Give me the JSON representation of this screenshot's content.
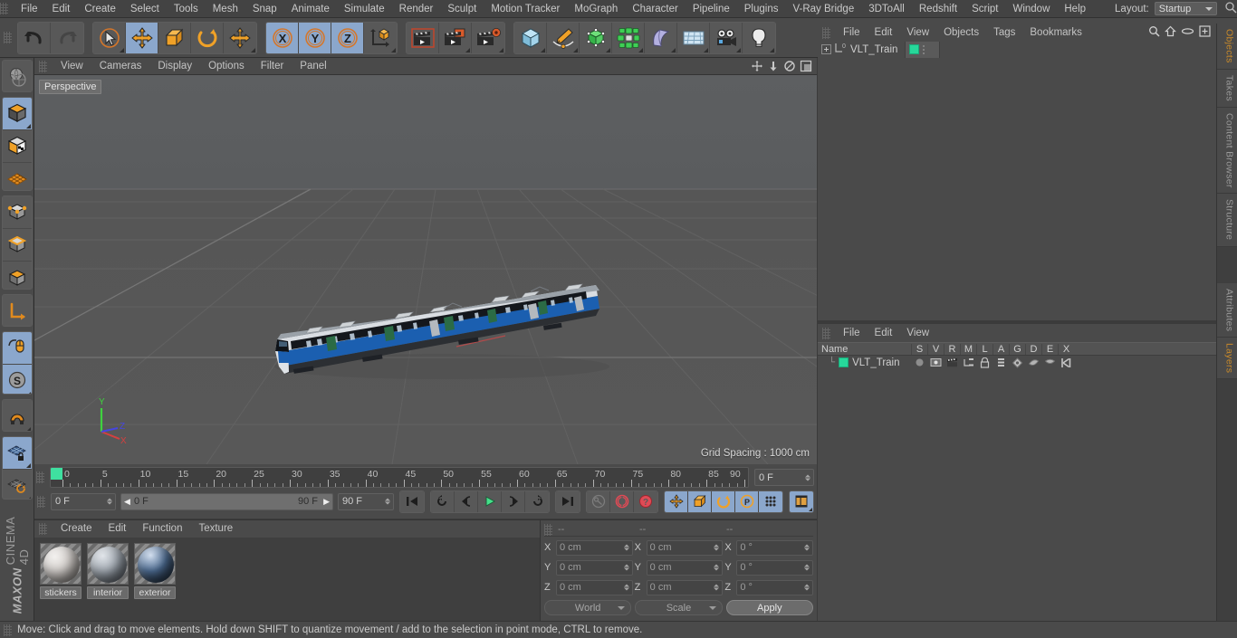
{
  "app": {
    "brand_top": "MAXON",
    "brand_bottom": "CINEMA 4D"
  },
  "menubar": {
    "items": [
      {
        "label": "File"
      },
      {
        "label": "Edit"
      },
      {
        "label": "Create"
      },
      {
        "label": "Select"
      },
      {
        "label": "Tools"
      },
      {
        "label": "Mesh"
      },
      {
        "label": "Snap"
      },
      {
        "label": "Animate"
      },
      {
        "label": "Simulate"
      },
      {
        "label": "Render"
      },
      {
        "label": "Sculpt"
      },
      {
        "label": "Motion Tracker"
      },
      {
        "label": "MoGraph"
      },
      {
        "label": "Character"
      },
      {
        "label": "Pipeline"
      },
      {
        "label": "Plugins"
      },
      {
        "label": "V-Ray Bridge"
      },
      {
        "label": "3DToAll"
      },
      {
        "label": "Redshift"
      },
      {
        "label": "Script"
      },
      {
        "label": "Window"
      },
      {
        "label": "Help"
      }
    ],
    "layout_label": "Layout:",
    "layout_value": "Startup",
    "search_icon": "search-icon"
  },
  "toolbar": {
    "groups": [
      {
        "name": "history",
        "buttons": [
          {
            "name": "undo-button",
            "icon": "undo-arrow-icon",
            "active": false
          },
          {
            "name": "redo-button",
            "icon": "redo-arrow-icon",
            "active": false
          }
        ]
      },
      {
        "name": "transform-tools",
        "buttons": [
          {
            "name": "live-selection-tool",
            "icon": "cursor-circle-icon",
            "active": false
          },
          {
            "name": "move-tool",
            "icon": "move-arrows-icon",
            "active": true
          },
          {
            "name": "scale-tool",
            "icon": "scale-box-icon",
            "active": false
          },
          {
            "name": "rotate-tool",
            "icon": "rotate-ring-icon",
            "active": false
          },
          {
            "name": "dynamic-place-tool",
            "icon": "move-arrows-icon",
            "active": false
          }
        ]
      },
      {
        "name": "axis-locks",
        "buttons": [
          {
            "name": "lock-x-axis-button",
            "icon": "x-axis-icon",
            "active": true
          },
          {
            "name": "lock-y-axis-button",
            "icon": "y-axis-icon",
            "active": true
          },
          {
            "name": "lock-z-axis-button",
            "icon": "z-axis-icon",
            "active": true
          },
          {
            "name": "world-object-axis-button",
            "icon": "world-axis-cube-icon",
            "active": false
          }
        ]
      },
      {
        "name": "render-tools",
        "buttons": [
          {
            "name": "render-view-button",
            "icon": "clapperboard-frame-icon",
            "active": false
          },
          {
            "name": "render-to-picture-viewer-button",
            "icon": "clapperboard-window-icon",
            "active": false
          },
          {
            "name": "render-settings-button",
            "icon": "clapperboard-gear-icon",
            "active": false
          }
        ]
      },
      {
        "name": "object-creation",
        "buttons": [
          {
            "name": "add-primitive-cube-button",
            "icon": "cube-icon",
            "active": false
          },
          {
            "name": "add-spline-pen-button",
            "icon": "pen-spline-icon",
            "active": false
          },
          {
            "name": "add-generator-button",
            "icon": "green-cube-generator-icon",
            "active": false
          },
          {
            "name": "add-array-button",
            "icon": "array-cluster-icon",
            "active": false
          },
          {
            "name": "add-deformer-bend-button",
            "icon": "bend-deformer-icon",
            "active": false
          },
          {
            "name": "add-scene-floor-button",
            "icon": "floor-grid-icon",
            "active": false
          },
          {
            "name": "add-camera-button",
            "icon": "camera-icon",
            "active": false
          },
          {
            "name": "add-light-button",
            "icon": "light-bulb-icon",
            "active": false
          }
        ]
      }
    ]
  },
  "leftbar": {
    "groups": [
      {
        "name": "render-region",
        "buttons": [
          {
            "name": "make-editable-globe-button",
            "icon": "globe-sphere-icon",
            "active": false
          }
        ]
      },
      {
        "name": "edit-modes",
        "buttons": [
          {
            "name": "model-mode-button",
            "icon": "model-cube-icon",
            "active": true
          },
          {
            "name": "texture-mode-button",
            "icon": "texture-cube-icon",
            "active": false
          },
          {
            "name": "uv-mode-button",
            "icon": "uv-mesh-icon",
            "active": false
          }
        ]
      },
      {
        "name": "component-modes",
        "buttons": [
          {
            "name": "points-mode-button",
            "icon": "points-cube-icon",
            "active": false
          },
          {
            "name": "edges-mode-button",
            "icon": "edges-cube-icon",
            "active": false
          },
          {
            "name": "polygons-mode-button",
            "icon": "polygons-cube-icon",
            "active": false
          }
        ]
      },
      {
        "name": "axis-mode",
        "buttons": [
          {
            "name": "enable-axis-modification-button",
            "icon": "axis-l-icon",
            "active": false
          }
        ]
      },
      {
        "name": "viewport-snap",
        "buttons": [
          {
            "name": "enable-snap-button",
            "icon": "mouse-snap-icon",
            "active": true
          },
          {
            "name": "soft-selection-button",
            "icon": "s-circle-icon",
            "active": true
          }
        ]
      },
      {
        "name": "magnet",
        "buttons": [
          {
            "name": "workplane-magnet-button",
            "icon": "magnet-icon",
            "active": false
          }
        ]
      },
      {
        "name": "workplane",
        "buttons": [
          {
            "name": "lock-workplane-button",
            "icon": "workplane-lock-icon",
            "active": true
          },
          {
            "name": "planar-workplane-button",
            "icon": "workplane-rotate-icon",
            "active": false
          }
        ]
      }
    ]
  },
  "viewport": {
    "menu": [
      {
        "label": "View"
      },
      {
        "label": "Cameras"
      },
      {
        "label": "Display"
      },
      {
        "label": "Options"
      },
      {
        "label": "Filter"
      },
      {
        "label": "Panel"
      }
    ],
    "icons": [
      {
        "name": "viewport-pan-icon"
      },
      {
        "name": "viewport-zoom-icon"
      },
      {
        "name": "viewport-rotate-icon"
      },
      {
        "name": "viewport-maximize-icon"
      }
    ],
    "label": "Perspective",
    "grid_spacing": "Grid Spacing : 1000 cm",
    "axis_labels": {
      "x": "X",
      "y": "Y",
      "z": "Z"
    },
    "axis_colors": {
      "x": "#d44040",
      "y": "#3fd23f",
      "z": "#4646e0"
    },
    "scene_object": "VLT_Train"
  },
  "timeline": {
    "ruler": {
      "start": 0,
      "end": 90,
      "major_step": 5,
      "labels": [
        "0",
        "5",
        "10",
        "15",
        "20",
        "25",
        "30",
        "35",
        "40",
        "45",
        "50",
        "55",
        "60",
        "65",
        "70",
        "75",
        "80",
        "85",
        "90"
      ]
    },
    "current_frame_field": "0 F",
    "frame_start_field": "0 F",
    "range_start": "0 F",
    "range_end": "90 F",
    "frame_end_field": "90 F",
    "transport": [
      {
        "name": "go-to-start-button",
        "icon": "skip-start-icon",
        "active": false
      },
      {
        "name": "play-backward-loop-button",
        "icon": "loop-back-icon",
        "active": false
      },
      {
        "name": "step-back-button",
        "icon": "step-back-icon",
        "active": false
      },
      {
        "name": "play-button",
        "icon": "play-icon",
        "active": false
      },
      {
        "name": "step-forward-button",
        "icon": "step-forward-icon",
        "active": false
      },
      {
        "name": "play-forward-loop-button",
        "icon": "loop-forward-icon",
        "active": false
      },
      {
        "name": "go-to-end-button",
        "icon": "skip-end-icon",
        "active": false
      }
    ],
    "keyframe_tools": [
      {
        "name": "autokeying-button",
        "icon": "key-icon",
        "active": false
      },
      {
        "name": "record-active-objects-button",
        "icon": "record-circle-icon",
        "active": false
      },
      {
        "name": "keyframe-selection-button",
        "icon": "question-circle-icon",
        "active": false
      }
    ],
    "record_toggles": [
      {
        "name": "record-position-button",
        "icon": "move-arrows-icon",
        "active": true
      },
      {
        "name": "record-scale-button",
        "icon": "scale-box-icon",
        "active": true
      },
      {
        "name": "record-rotation-button",
        "icon": "rotate-ring-icon",
        "active": true
      },
      {
        "name": "record-parameter-button",
        "icon": "p-circle-icon",
        "active": true
      },
      {
        "name": "record-pla-button",
        "icon": "point-grid-icon",
        "active": true
      }
    ],
    "timeline-toggle": {
      "name": "timeline-button",
      "icon": "film-strip-icon",
      "active": true
    }
  },
  "materials": {
    "menu": [
      {
        "label": "Create"
      },
      {
        "label": "Edit"
      },
      {
        "label": "Function"
      },
      {
        "label": "Texture"
      }
    ],
    "items": [
      {
        "name": "stickers",
        "color_a": "#e8e6e4",
        "color_b": "#b9b4b0"
      },
      {
        "name": "interior",
        "color_a": "#cfd2d6",
        "color_b": "#7d838b"
      },
      {
        "name": "exterior",
        "color_a": "#b9c6d6",
        "color_b": "#3a4450"
      }
    ]
  },
  "coordinates": {
    "header": [
      "--",
      "--",
      "--"
    ],
    "axes": [
      "X",
      "Y",
      "Z"
    ],
    "position": [
      "0 cm",
      "0 cm",
      "0 cm"
    ],
    "size": [
      "0 cm",
      "0 cm",
      "0 cm"
    ],
    "rotation": [
      "0 °",
      "0 °",
      "0 °"
    ],
    "space_select": "World",
    "mode_select": "Scale",
    "apply_label": "Apply"
  },
  "object_manager": {
    "menu": [
      {
        "label": "File"
      },
      {
        "label": "Edit"
      },
      {
        "label": "View"
      },
      {
        "label": "Objects"
      },
      {
        "label": "Tags"
      },
      {
        "label": "Bookmarks"
      }
    ],
    "icons": [
      {
        "name": "search-icon"
      },
      {
        "name": "home-icon"
      },
      {
        "name": "ellipse-icon"
      },
      {
        "name": "add-box-icon"
      }
    ],
    "rows": [
      {
        "name": "VLT_Train",
        "layer_color": "#27d79a",
        "expandable": true
      }
    ]
  },
  "layer_manager": {
    "menu": [
      {
        "label": "File"
      },
      {
        "label": "Edit"
      },
      {
        "label": "View"
      }
    ],
    "columns": [
      "Name",
      "S",
      "V",
      "R",
      "M",
      "L",
      "A",
      "G",
      "D",
      "E",
      "X"
    ],
    "rows": [
      {
        "name": "VLT_Train",
        "color": "#27d79a",
        "cells": [
          "solo-dot-icon",
          "view-icon",
          "render-icon",
          "manager-icon",
          "lock-icon",
          "animation-icon",
          "generator-icon",
          "deformer-icon",
          "expression-icon",
          "xref-icon"
        ]
      }
    ]
  },
  "right_tabs": [
    {
      "label": "Objects",
      "highlight": true
    },
    {
      "label": "Takes",
      "highlight": false
    },
    {
      "label": "Content Browser",
      "highlight": false
    },
    {
      "label": "Structure",
      "highlight": false
    },
    {
      "label": "Attributes",
      "highlight": false
    },
    {
      "label": "Layers",
      "highlight": true
    }
  ],
  "statusbar": {
    "message": "Move: Click and drag to move elements. Hold down SHIFT to quantize movement / add to the selection in point mode, CTRL to remove."
  },
  "colors": {
    "accent_orange": "#e08a1e",
    "active_blue": "#8ba7cc",
    "layer_green": "#27d79a",
    "panel_bg": "#4a4a4a",
    "viewport_bg": "#565656"
  }
}
